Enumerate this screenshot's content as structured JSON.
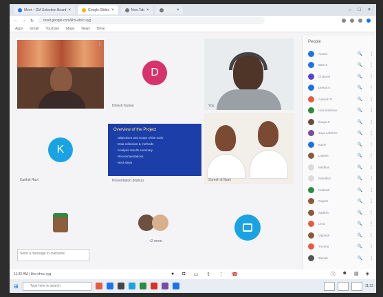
{
  "browser": {
    "tabs": [
      {
        "label": "Meet – GM Selection Board",
        "active": false
      },
      {
        "label": "Google Slides",
        "active": true
      },
      {
        "label": "New Tab",
        "active": false
      },
      {
        "label": "",
        "active": false
      }
    ],
    "url": "meet.google.com/khx-ehvc-cyg",
    "bookmarks": [
      "Apps",
      "Gmail",
      "YouTube",
      "Maps",
      "News",
      "Drive"
    ]
  },
  "meeting": {
    "tiles": [
      {
        "name": "",
        "kind": "video"
      },
      {
        "name": "Dinesh Kumar",
        "kind": "avatar",
        "letter": "D",
        "color": "#d6336c"
      },
      {
        "name": "You",
        "kind": "video"
      },
      {
        "name": "Karthik Ravi",
        "kind": "avatar",
        "letter": "K",
        "color": "#1aa3e3"
      },
      {
        "name": "Presentation (Rahul)",
        "kind": "slide"
      },
      {
        "name": "Suresh & Mani",
        "kind": "video"
      },
      {
        "name": "",
        "kind": "photo"
      },
      {
        "name": "+2 more",
        "kind": "group"
      },
      {
        "name": "",
        "kind": "icon"
      }
    ],
    "slide": {
      "title": "Overview of the Project",
      "lines": [
        "Objectives and scope of the work",
        "Data collection & methods",
        "Analysis results summary",
        "Recommendations",
        "Next steps"
      ]
    },
    "chat_placeholder": "Send a message to everyone",
    "meeting_code": "11:32 AM | khx-ehvc-cyg"
  },
  "panel": {
    "title": "People",
    "participants": [
      {
        "name": "Anand",
        "color": "#1a73e8"
      },
      {
        "name": "Bala S",
        "color": "#1a73e8"
      },
      {
        "name": "Chitra M",
        "color": "#5b3fd1"
      },
      {
        "name": "Deepa K",
        "color": "#1a73e8"
      },
      {
        "name": "Ganesh P",
        "color": "#e8593f"
      },
      {
        "name": "Hari Krishnan",
        "color": "#2d8a3e"
      },
      {
        "name": "Ilango R",
        "color": "#6b4c3a"
      },
      {
        "name": "Jaya Lakshmi",
        "color": "#7a4aa1"
      },
      {
        "name": "Kavin",
        "color": "#1a73e8"
      },
      {
        "name": "Lokesh",
        "color": "#8a5a3a"
      },
      {
        "name": "Madhan",
        "color": "#dbdbdb"
      },
      {
        "name": "Nandhini",
        "color": "#dbdbdb"
      },
      {
        "name": "Prakash",
        "color": "#2d8a3e"
      },
      {
        "name": "Rajesh",
        "color": "#8a5a3a"
      },
      {
        "name": "Sathish",
        "color": "#8a5a3a"
      },
      {
        "name": "Uma",
        "color": "#e8593f"
      },
      {
        "name": "Vignesh",
        "color": "#8a5a3a"
      },
      {
        "name": "Yuvaraj",
        "color": "#e8593f"
      },
      {
        "name": "Zainab",
        "color": "#555555"
      }
    ]
  },
  "taskbar": {
    "search_placeholder": "Type here to search",
    "time": "11:32"
  }
}
